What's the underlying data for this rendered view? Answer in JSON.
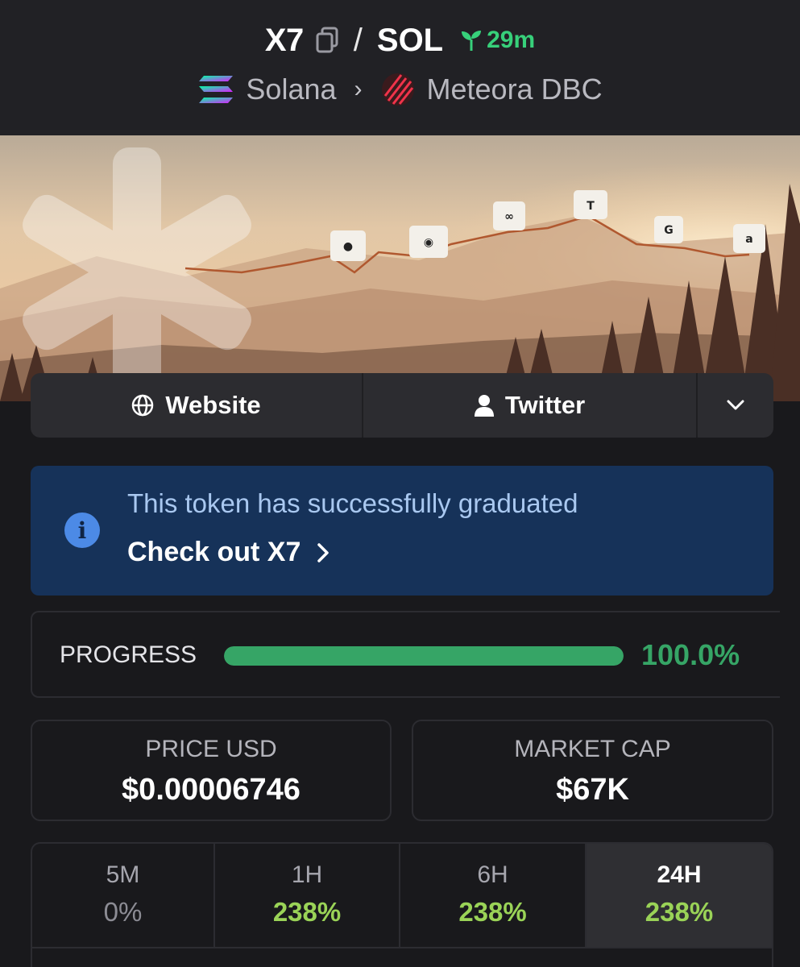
{
  "header": {
    "token_symbol": "X7",
    "separator": "/",
    "quote_symbol": "SOL",
    "age": "29m",
    "chain": "Solana",
    "dex": "Meteora DBC"
  },
  "banner": {
    "logos": [
      "apple-logo",
      "nvidia-logo",
      "meta-logo",
      "tesla-logo",
      "google-logo",
      "amazon-logo"
    ]
  },
  "links": {
    "website": "Website",
    "twitter": "Twitter"
  },
  "graduated": {
    "message": "This token has successfully graduated",
    "link": "Check out X7"
  },
  "progress": {
    "label": "PROGRESS",
    "value_text": "100.0%",
    "fraction": 1.0
  },
  "stats": {
    "price_label": "PRICE USD",
    "price_value": "$0.00006746",
    "mcap_label": "MARKET CAP",
    "mcap_value": "$67K"
  },
  "changes": [
    {
      "label": "5M",
      "value": "0%"
    },
    {
      "label": "1H",
      "value": "238%"
    },
    {
      "label": "6H",
      "value": "238%"
    },
    {
      "label": "24H",
      "value": "238%"
    }
  ],
  "colors": {
    "positive": "#9ad357",
    "progress": "#36a566",
    "info_bg": "#163259",
    "age": "#37d07a"
  }
}
